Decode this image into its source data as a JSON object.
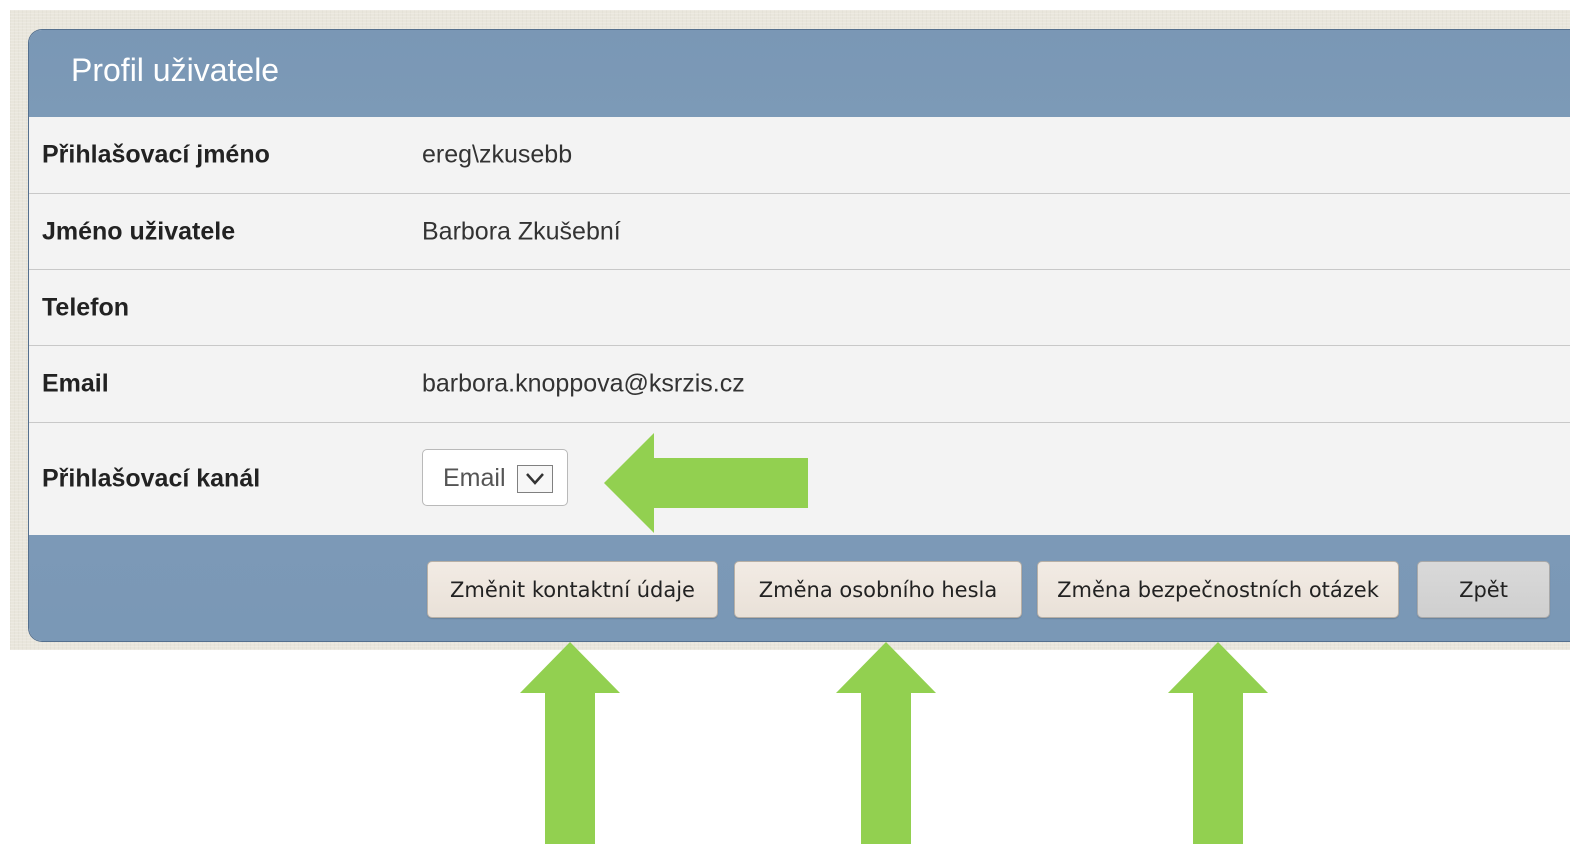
{
  "panel": {
    "title": "Profil uživatele"
  },
  "rows": [
    {
      "label": "Přihlašovací jméno",
      "value": "ereg\\zkusebb"
    },
    {
      "label": "Jméno uživatele",
      "value": "Barbora Zkušební"
    },
    {
      "label": "Telefon",
      "value": ""
    },
    {
      "label": "Email",
      "value": "barbora.knoppova@ksrzis.cz"
    },
    {
      "label": "Přihlašovací kanál",
      "selected": "Email"
    }
  ],
  "buttons": {
    "change_contact": "Změnit kontaktní údaje",
    "change_password": "Změna osobního hesla",
    "change_questions": "Změna bezpečnostních otázek",
    "back": "Zpět"
  },
  "colors": {
    "header": "#7c9ab7",
    "annotation_arrow": "#92d050",
    "row_bg": "#f3f3f3"
  },
  "icons": {
    "dropdown": "chevron-down-icon",
    "annotation": "arrow-icon"
  }
}
